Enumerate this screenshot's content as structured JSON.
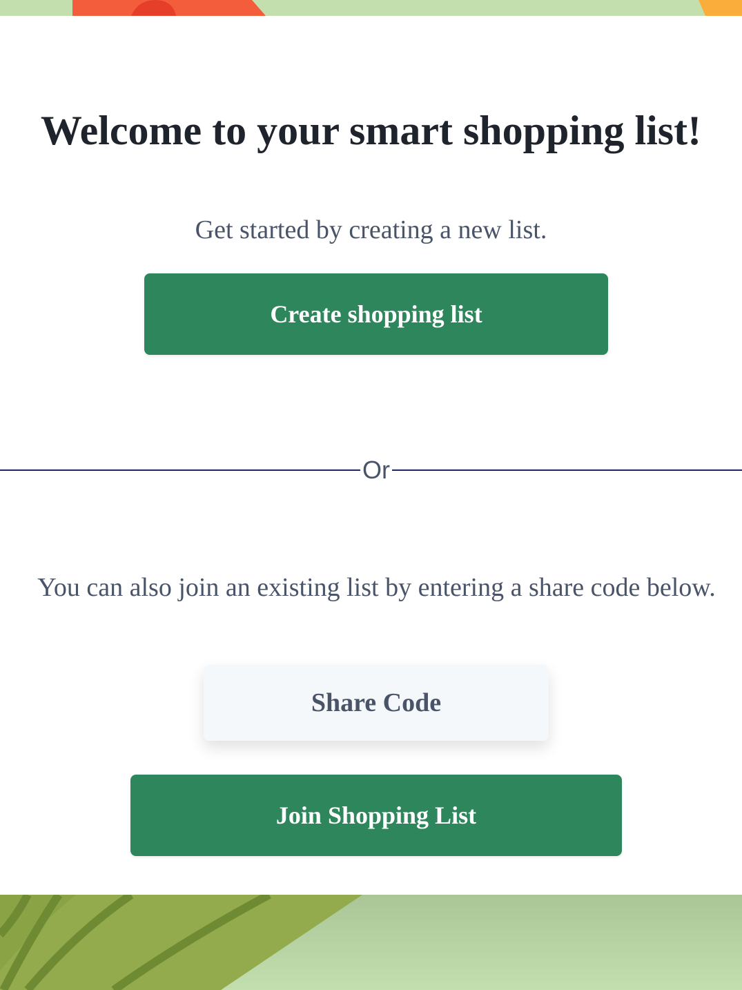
{
  "welcome": {
    "title": "Welcome to your smart shopping list!",
    "subtitle": "Get started by creating a new list.",
    "create_button_label": "Create shopping list"
  },
  "divider": {
    "label": "Or"
  },
  "join": {
    "description": "You can also join an existing list by entering a share code below.",
    "share_code_placeholder": "Share Code",
    "join_button_label": "Join Shopping List"
  },
  "colors": {
    "primary_button": "#2e865c",
    "divider_line": "#1c2766",
    "body_text": "#4a5468",
    "heading_text": "#1f232b",
    "banner_green": "#c3dfad"
  },
  "icons": {
    "top_banner": "decorative-fruit-illustration",
    "bottom_banner": "decorative-leaf-illustration"
  }
}
